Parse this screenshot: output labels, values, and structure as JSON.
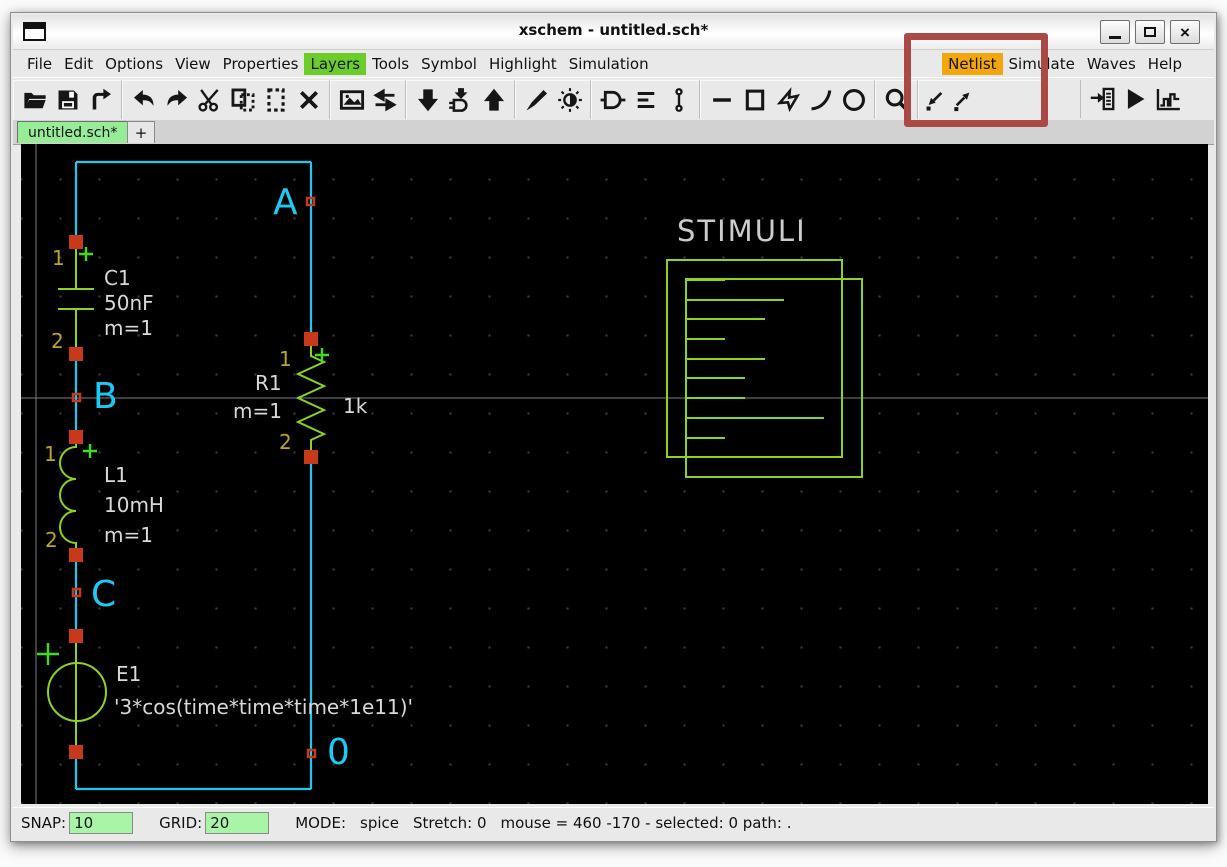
{
  "window": {
    "title": "xschem - untitled.sch*",
    "controls": [
      "minimize",
      "maximize",
      "close"
    ]
  },
  "menubar": {
    "left": [
      {
        "label": "File"
      },
      {
        "label": "Edit"
      },
      {
        "label": "Options"
      },
      {
        "label": "View"
      },
      {
        "label": "Properties"
      },
      {
        "label": "Layers",
        "highlight": "green"
      },
      {
        "label": "Tools"
      },
      {
        "label": "Symbol"
      },
      {
        "label": "Highlight"
      },
      {
        "label": "Simulation"
      }
    ],
    "right": [
      {
        "label": "Netlist",
        "highlight": "orange"
      },
      {
        "label": "Simulate"
      },
      {
        "label": "Waves"
      },
      {
        "label": "Help"
      }
    ]
  },
  "toolbar": {
    "groups": [
      [
        "open-file",
        "save-file",
        "reload-file"
      ],
      [
        "undo",
        "redo",
        "cut",
        "copy",
        "paste",
        "delete"
      ],
      [
        "place-symbol",
        "swap-layout"
      ],
      [
        "push-schematic",
        "push-symbol",
        "pop-hierarchy"
      ],
      [
        "draw-edit",
        "toggle-colors"
      ],
      [
        "make-symbol",
        "show-netlist",
        "place-pin"
      ],
      [
        "draw-wire",
        "draw-rect",
        "draw-polygon",
        "draw-arc",
        "draw-circle"
      ],
      [
        "zoom-box"
      ],
      [
        "zoom-full",
        "zoom-in"
      ]
    ],
    "right": [
      "netlist",
      "simulate",
      "waves"
    ]
  },
  "tabs": {
    "active": "untitled.sch*",
    "new_tab": "+"
  },
  "canvas": {
    "nodes": {
      "a": "A",
      "b": "B",
      "c": "C",
      "gnd": "0"
    },
    "c1": {
      "ref": "C1",
      "value": "50nF",
      "m": "m=1",
      "pin1": "1",
      "pin2": "2",
      "plus": "+"
    },
    "l1": {
      "ref": "L1",
      "value": "10mH",
      "m": "m=1",
      "pin1": "1",
      "pin2": "2",
      "plus": "+"
    },
    "r1": {
      "ref": "R1",
      "value": "1k",
      "m": "m=1",
      "pin1": "1",
      "pin2": "2",
      "plus": "+"
    },
    "e1": {
      "ref": "E1",
      "value": "'3*cos(time*time*time*1e11)'",
      "plus": "+"
    },
    "stimuli": {
      "label": "STIMULI"
    }
  },
  "statusbar": {
    "snap_label": "SNAP:",
    "snap_value": "10",
    "grid_label": "GRID:",
    "grid_value": "20",
    "mode_label": "MODE:",
    "mode_value": "spice",
    "stretch_text": "Stretch: 0",
    "mouse_text": "mouse = 460 -170 - selected: 0 path: ."
  },
  "colors": {
    "wire_cyan": "#1ec9f0",
    "label_cyan": "#19ccf5",
    "sym_green": "#8ed31f",
    "plus_green": "#42de12",
    "pin_red": "#c8391b",
    "pin_number_yellow": "#b9a621",
    "schematic_text": "#d9d9d9",
    "stimuli_text": "#cccccc",
    "menu_green": "#6ccd2a",
    "menu_orange": "#f2a70c",
    "tab_green": "#97ed97",
    "field_green": "#a8f5a8",
    "annotation_red": "#a94a44",
    "grid_dot": "#3d3d3d",
    "axis_gray": "#7e7e7e"
  }
}
